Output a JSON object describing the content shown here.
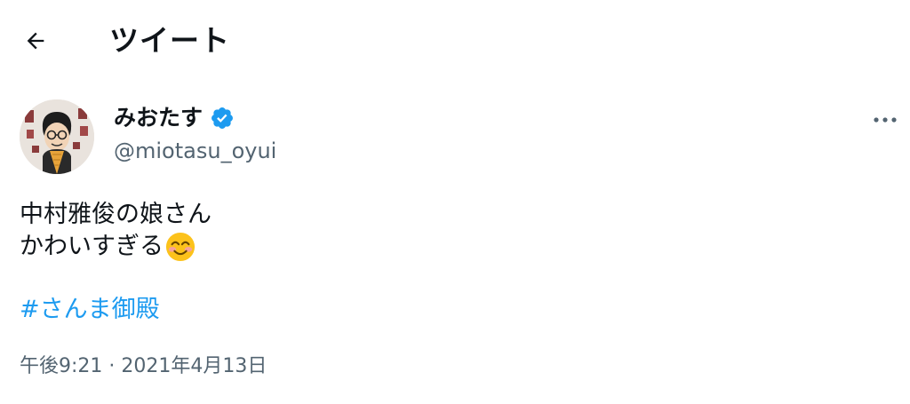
{
  "header": {
    "title": "ツイート",
    "back_icon": "arrow-left-icon"
  },
  "author": {
    "display_name": "みおたす",
    "handle": "@miotasu_oyui",
    "verified_icon": "verified-badge-icon",
    "verified_color": "#1d9bf0"
  },
  "tweet": {
    "lines": [
      "中村雅俊の娘さん",
      "かわいすぎる"
    ],
    "emoji": "smiling-face-with-smiling-eyes-emoji",
    "hashtag": "#さんま御殿",
    "time": "午後9:21",
    "separator": "·",
    "date": "2021年4月13日"
  },
  "more_icon": "more-dots-icon",
  "colors": {
    "text": "#0f1419",
    "secondary": "#536471",
    "link": "#1d9bf0"
  }
}
